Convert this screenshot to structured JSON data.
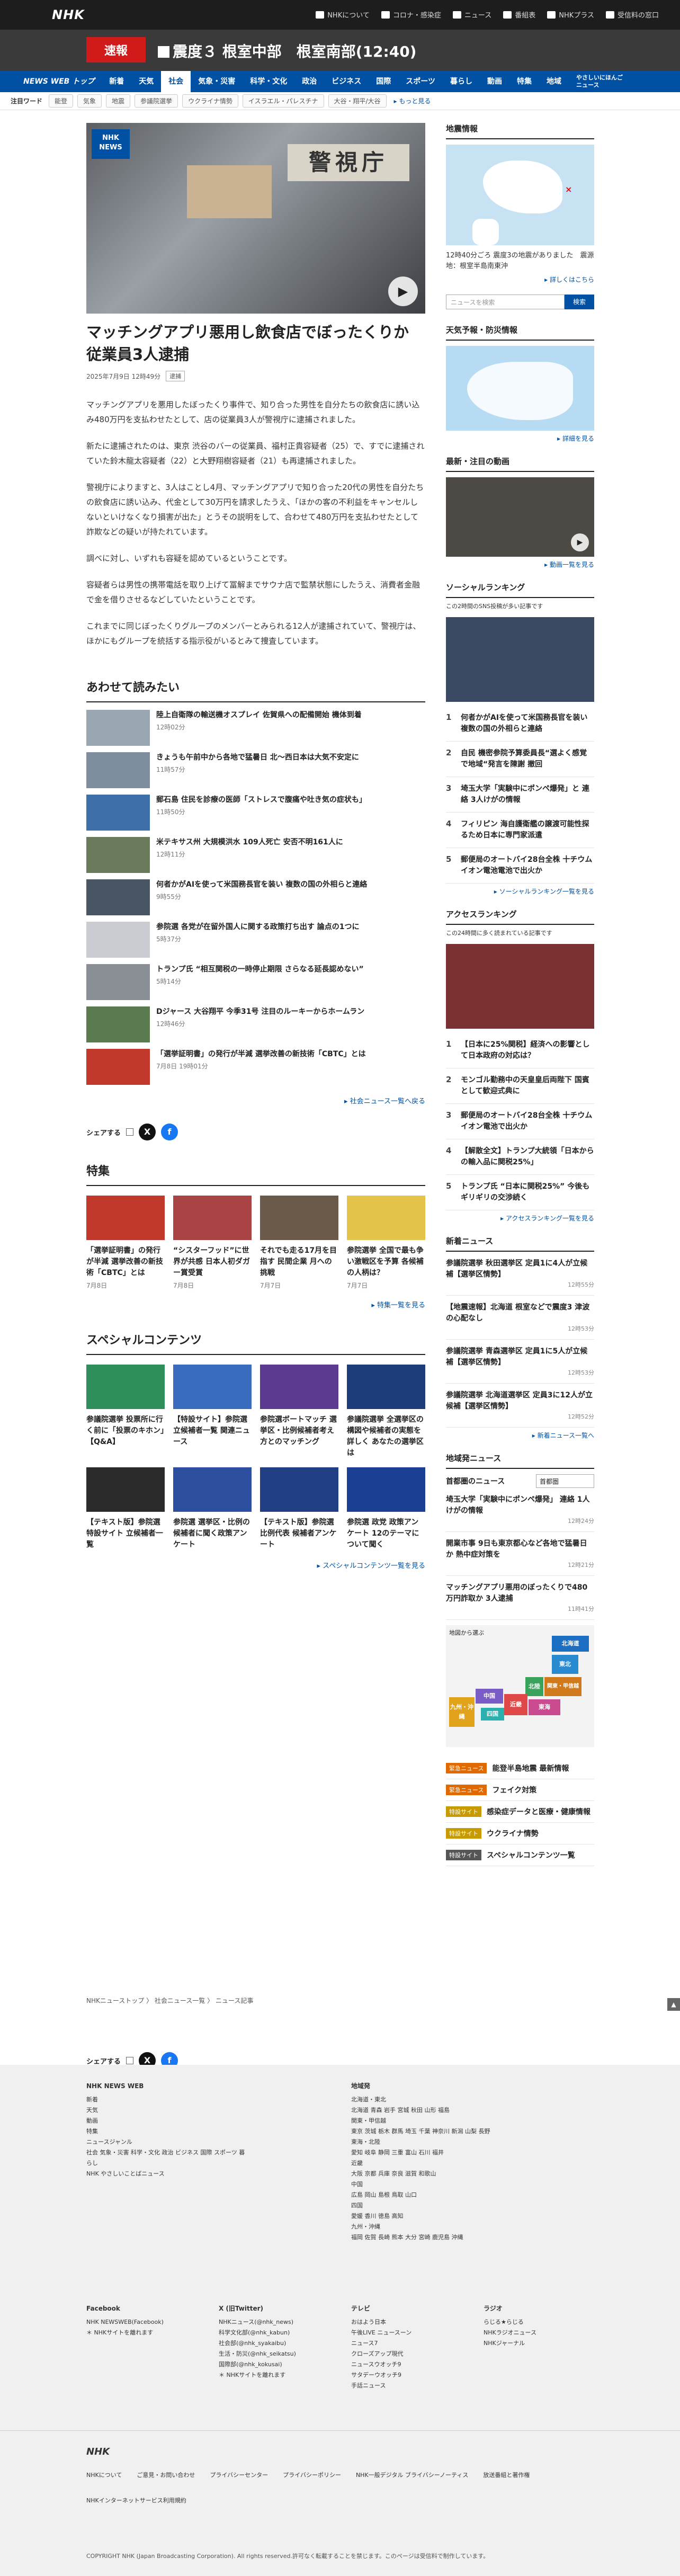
{
  "header": {
    "logo": "NHK",
    "links": [
      "NHKについて",
      "コロナ・感染症",
      "ニュース",
      "番組表",
      "NHKプラス",
      "受信料の窓口"
    ]
  },
  "breaking": {
    "tag": "速報",
    "text": "震度３ 根室中部　根室南部(12:40)"
  },
  "nav": {
    "brand": "NEWS WEB トップ",
    "items": [
      "新着",
      "天気",
      "社会",
      "気象・災害",
      "科学・文化",
      "政治",
      "ビジネス",
      "国際",
      "スポーツ",
      "暮らし",
      "動画",
      "特集",
      "地域",
      "やさしいにほんごニュース"
    ],
    "active_index": 2
  },
  "keywords": {
    "label": "注目ワード",
    "items": [
      "能登",
      "気象",
      "地震",
      "参議院選挙",
      "ウクライナ情勢",
      "イスラエル・パレスチナ",
      "大谷・翔平/大谷"
    ],
    "more": "▸ もっと見る"
  },
  "article": {
    "title": "マッチングアプリ悪用し飲食店でぼったくりか 従業員3人逮捕",
    "date": "2025年7月9日 12時49分",
    "category": "逮捕",
    "paragraphs": [
      "マッチングアプリを悪用したぼったくり事件で、知り合った男性を自分たちの飲食店に誘い込み480万円を支払わせたとして、店の従業員3人が警視庁に逮捕されました。",
      "新たに逮捕されたのは、東京 渋谷のバーの従業員、福村正貴容疑者（25）で、すでに逮捕されていた鈴木龍太容疑者（22）と大野翔樹容疑者（21）も再逮捕されました。",
      "警視庁によりますと、3人はことし4月、マッチングアプリで知り合った20代の男性を自分たちの飲食店に誘い込み、代金として30万円を請求したうえ、「ほかの客の不利益をキャンセルしないといけなくなり損害が出た」とうその説明をして、合わせて480万円を支払わせたとして詐欺などの疑いが持たれています。",
      "調べに対し、いずれも容疑を認めているということです。",
      "容疑者らは男性の携帯電話を取り上げて冨解までサウナ店で監禁状態にしたうえ、消費者金融で金を借りさせるなどしていたということです。",
      "これまでに同じぼったくりグループのメンバーとみられる12人が逮捕されていて、警視庁は、ほかにもグループを統括する指示役がいるとみて捜査しています。"
    ]
  },
  "related": {
    "heading": "あわせて読みたい",
    "items": [
      {
        "title": "陸上自衛隊の輸送機オスプレイ 佐賀県への配備開始 機体到着",
        "time": "12時02分"
      },
      {
        "title": "きょうも午前中から各地で猛暑日 北〜西日本は大気不安定に",
        "time": "11時57分"
      },
      {
        "title": "郵石島 住民を診療の医師「ストレスで腹痛や吐き気の症状も」",
        "time": "11時50分"
      },
      {
        "title": "米テキサス州 大規模洪水 109人死亡 安否不明161人に",
        "time": "12時11分"
      },
      {
        "title": "何者かがAIを使って米国務長官を装い 複数の国の外相らと連絡",
        "time": "9時55分"
      },
      {
        "title": "参院選 各党が在留外国人に関する政策打ち出す 論点の1つに",
        "time": "5時37分"
      },
      {
        "title": "トランプ氏 “相互関税の一時停止期限 さらなる延長認めない”",
        "time": "5時14分"
      },
      {
        "title": "Dジャース 大谷翔平 今季31号 注目のルーキーからホームラン",
        "time": "12時46分"
      },
      {
        "title": "「選挙証明書」の発行が半減 選挙改善の新技術「CBTC」とは",
        "time": "7月8日 19時01分"
      }
    ],
    "more": "▸ 社会ニュース一覧へ戻る"
  },
  "share": {
    "label": "シェアする"
  },
  "features": {
    "heading": "特集",
    "items": [
      {
        "title": "「選挙証明書」の発行が半減 選挙改善の新技術「CBTC」とは",
        "date": "7月8日"
      },
      {
        "title": "“シスターフッド”に世界が共感 日本人初ダガー賞受賞",
        "date": "7月8日"
      },
      {
        "title": "それでも走る17月を目指す 民間企業 月への挑戦",
        "date": "7月7日"
      },
      {
        "title": "参院選挙 全国で最も争い激戦区を予算 各候補の人柄は？",
        "date": "7月7日"
      }
    ],
    "more": "▸ 特集一覧を見る"
  },
  "special": {
    "heading": "スペシャルコンテンツ",
    "items": [
      "参議院選挙 投票所に行く前に「投票のキホン」【Q&A】",
      "【特設サイト】参院選 立候補者一覧 関連ニュース",
      "参院選ボートマッチ 選挙区・比例候補者考え方とのマッチング",
      "参議院選挙 全選挙区の構図や候補者の実態を詳しく あなたの選挙区は",
      "【テキスト版】参院選特設サイト 立候補者一覧",
      "参院選 選挙区・比例の候補者に聞く政策アンケート",
      "【テキスト版】参院選 比例代表 候補者アンケート",
      "参院選 政党 政策アンケート 12のテーマについて聞く"
    ],
    "more": "▸ スペシャルコンテンツ一覧を見る"
  },
  "sidebar": {
    "quake": {
      "heading": "地震情報",
      "text": "12時40分ごろ 震度3の地震がありました　震源地：根室半島南東沖",
      "more": "▸ 詳しくはこちら"
    },
    "search": {
      "placeholder": "ニュースを検索",
      "button": "検索"
    },
    "weather": {
      "heading": "天気予報・防災情報",
      "more": "▸ 詳細を見る"
    },
    "video": {
      "heading": "最新・注目の動画",
      "more": "▸ 動画一覧を見る"
    },
    "social_ranking": {
      "heading": "ソーシャルランキング",
      "sub": "この2時間のSNS投稿が多い記事です",
      "items": [
        "何者かがAIを使って米国務長官を装い 複数の国の外相らと連絡",
        "自民 機密参院予算委員長“選よく感覚で地域“発言を陳謝 撤回",
        "埼玉大学「実験中にポンペ爆発」と 連絡 3人けがの情報",
        "フィリピン 海自護衛艦の譲渡可能性探るため日本に専門家派遣",
        "郵便局のオートバイ28台全株 十チウム イオン電池電池で出火か"
      ],
      "more": "▸ ソーシャルランキング一覧を見る"
    },
    "access_ranking": {
      "heading": "アクセスランキング",
      "sub": "この24時間に多く読まれている記事です",
      "items": [
        "【日本に25%関税】経済への影響として日本政府の対応は？",
        "モンゴル勤務中の天皇皇后両陛下 国賓として歓迎式典に",
        "郵便局のオートバイ28台全株 十チウム イオン電池で出火か",
        "【解散全文】トランプ大統領「日本からの輸入品に関税25%」",
        "トランプ氏 “日本に関税25%” 今後もギリギリの交渉続く"
      ],
      "more": "▸ アクセスランキング一覧を見る"
    },
    "new_news": {
      "heading": "新着ニュース",
      "items": [
        {
          "title": "参議院選挙 秋田選挙区 定員1に4人が立候補【選挙区情勢】",
          "time": "12時55分"
        },
        {
          "title": "【地震速報】北海道 根室などで震度3 津波の心配なし",
          "time": "12時53分"
        },
        {
          "title": "参議院選挙 青森選挙区 定員1に5人が立候補【選挙区情勢】",
          "time": "12時53分"
        },
        {
          "title": "参議院選挙 北海道選挙区 定員3に12人が立候補【選挙区情勢】",
          "time": "12時52分"
        }
      ],
      "more": "▸ 新着ニュース一覧へ"
    },
    "regional": {
      "heading": "地域発ニュース",
      "label": "首都圏のニュース",
      "select": "首都圏",
      "items": [
        {
          "title": "埼玉大学「実験中にポンペ爆発」 連絡 1人けがの情報",
          "time": "12時24分"
        },
        {
          "title": "開業市事 9日も東京都心など各地で猛暑日か 熱中症対策を",
          "time": "12時21分"
        },
        {
          "title": "マッチングアプリ悪用のぼったくりで480万円詐取か 3人逮捕",
          "time": "11時41分"
        }
      ],
      "map_label": "地図から選ぶ",
      "regions": [
        "北海道",
        "東北",
        "関東・甲信越",
        "東海",
        "北陸",
        "近畿",
        "中国",
        "四国",
        "九州・沖縄"
      ]
    },
    "tags": [
      {
        "badge": "緊急ニュース",
        "title": "能登半島地震 最新情報",
        "color": "#e06a00"
      },
      {
        "badge": "緊急ニュース",
        "title": "フェイク対策",
        "color": "#e06a00"
      },
      {
        "badge": "特設サイト",
        "title": "感染症データと医療・健康情報",
        "color": "#c79a00"
      },
      {
        "badge": "特設サイト",
        "title": "ウクライナ情勢",
        "color": "#c79a00"
      },
      {
        "badge": "特設サイト",
        "title": "スペシャルコンテンツ一覧",
        "color": "#555555"
      }
    ]
  },
  "breadcrumb": "NHKニューストップ 〉 社会ニュース一覧 〉 ニュース記事",
  "footer": {
    "col1_head": "NHK NEWS WEB",
    "col1": [
      "新着",
      "天気",
      "動画",
      "特集",
      "ニュースジャンル",
      "社会 気象・災害 科学・文化 政治 ビジネス 国際 スポーツ 暮らし",
      "NHK やさしいことばニュース"
    ],
    "col2_head": "地域発",
    "col2": [
      "北海道・東北",
      "北海道 青森 岩手 宮城 秋田 山形 福島",
      "関東・甲信越",
      "東京 茨城 栃木 群馬 埼玉 千葉 神奈川 新潟 山梨 長野",
      "東海・北陸",
      "愛知 岐阜 静岡 三重 富山 石川 福井",
      "近畿",
      "大阪 京都 兵庫 奈良 滋賀 和歌山",
      "中国",
      "広島 岡山 島根 鳥取 山口",
      "四国",
      "愛媛 香川 徳島 高知",
      "九州・沖縄",
      "福岡 佐賀 長崎 熊本 大分 宮崎 鹿児島 沖縄"
    ],
    "col3_head": "Facebook",
    "col3": [
      "NHK NEWSWEB(Facebook)",
      "＊ NHKサイトを離れます"
    ],
    "col4_head": "X (旧Twitter)",
    "col4": [
      "NHKニュース(@nhk_news)",
      "科学文化部(@nhk_kabun)",
      "社会部(@nhk_syakaibu)",
      "生活・防災(@nhk_seikatsu)",
      "国際部(@nhk_kokusai)",
      "＊ NHKサイトを離れます"
    ],
    "col5_head": "テレビ",
    "col5": [
      "おはよう日本",
      "午後LIVE ニュースーン",
      "ニュース7",
      "クローズアップ現代",
      "ニュースウオッチ9",
      "サタデーウオッチ9",
      "手話ニュース"
    ],
    "col6_head": "ラジオ",
    "col6": [
      "らじる★らじる",
      "NHKラジオニュース",
      "NHKジャーナル"
    ],
    "bottom_links": [
      "NHKについて",
      "ご意見・お問い合わせ",
      "プライバシーセンター",
      "プライバシーポリシー",
      "NHK一般デジタル ブライバシーノーティス",
      "放送番組と著作権",
      "NHKインターネットサービス利用規約"
    ],
    "copyright": "COPYRIGHT NHK (Japan Broadcasting Corporation). All rights reserved.許可なく転載することを禁じます。このページは受信料で制作しています。"
  }
}
